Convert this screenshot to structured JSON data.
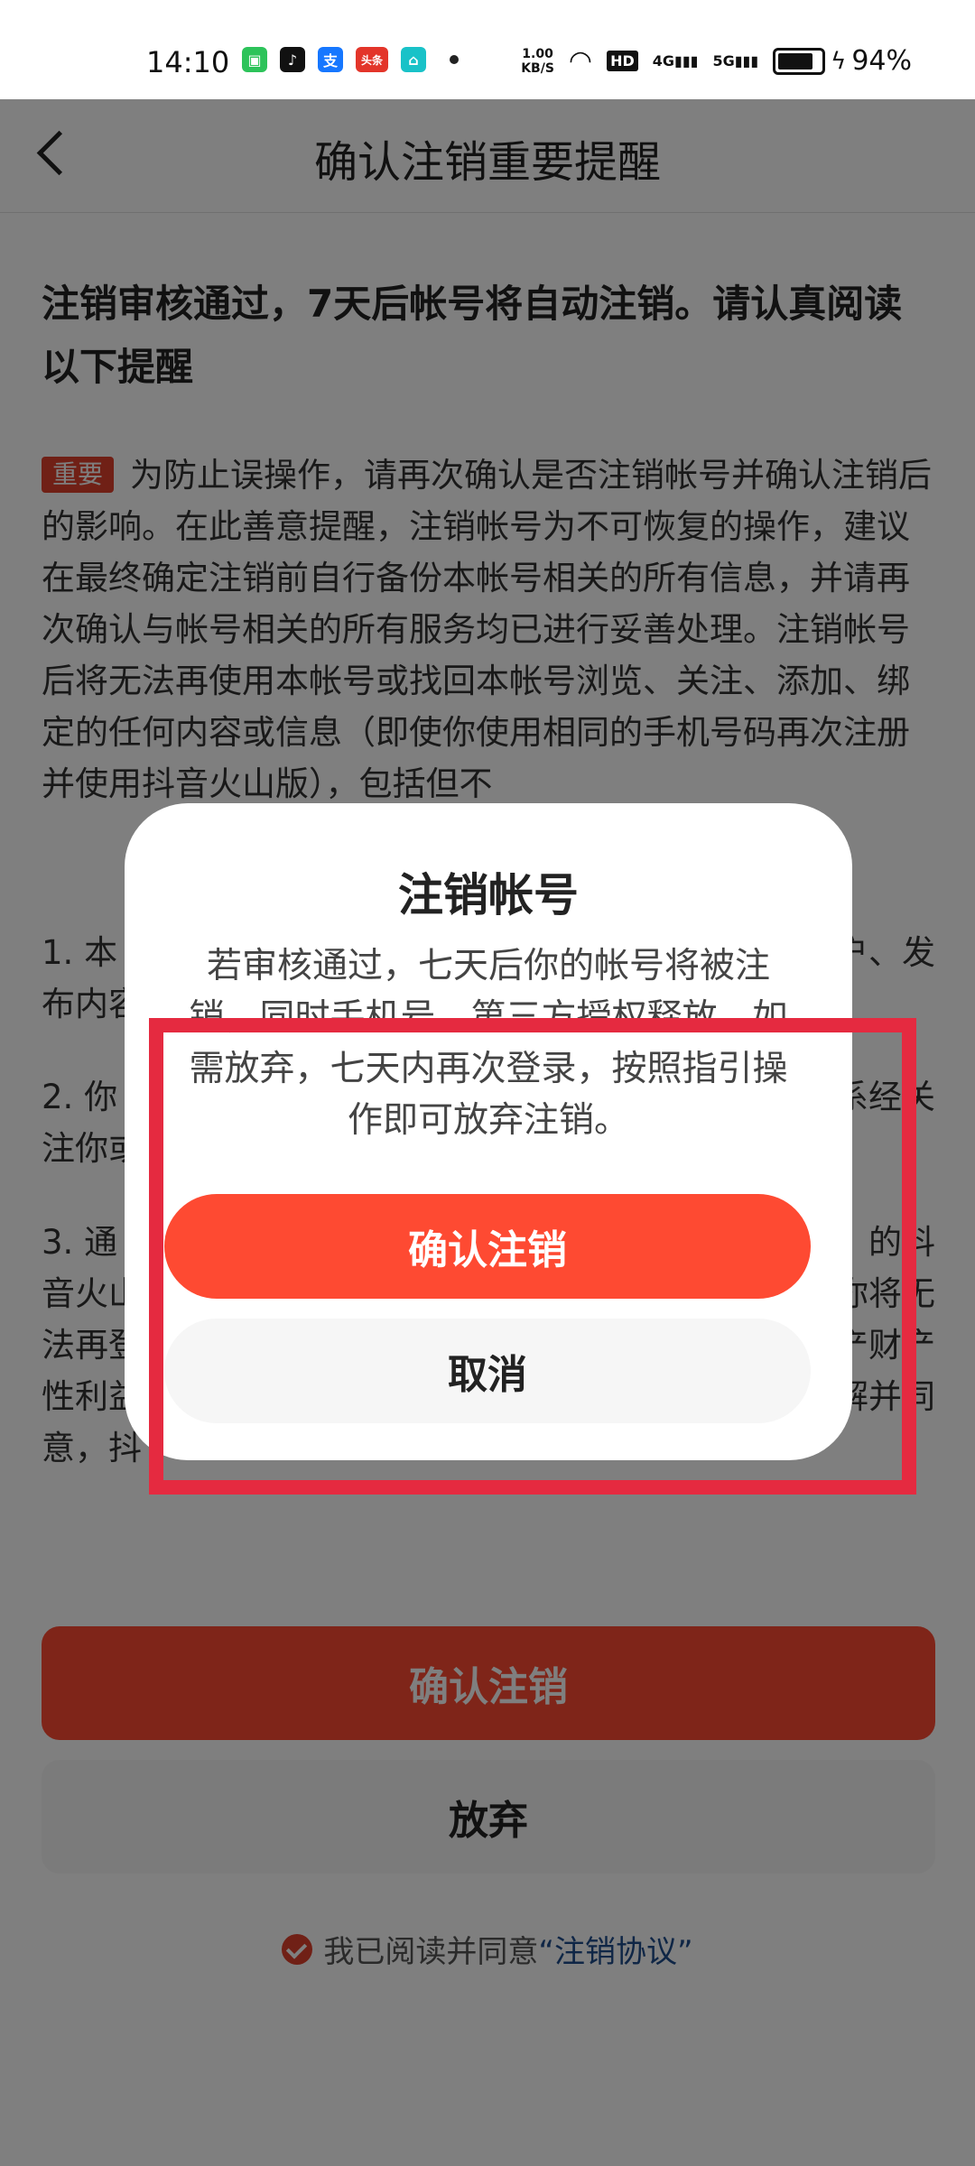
{
  "status_bar": {
    "time": "14:10",
    "net_speed_value": "1.00",
    "net_speed_unit": "KB/S",
    "hd": "HD",
    "signal1": "4G",
    "signal2": "5G",
    "battery": "94%",
    "battery_level": 0.94,
    "app_icons": [
      "wechat-icon",
      "douyin-icon",
      "alipay-icon",
      "toutiao-icon",
      "home-app-icon"
    ],
    "toutiao_text": "头条",
    "alipay_text": "支"
  },
  "nav": {
    "title": "确认注销重要提醒"
  },
  "content": {
    "headline": "注销审核通过，7天后帐号将自动注销。请认真阅读以下提醒",
    "tag": "重要",
    "paragraph": "为防止误操作，请再次确认是否注销帐号并确认注销后的影响。在此善意提醒，注销帐号为不可恢复的操作，建议在最终确定注销前自行备份本帐号相关的所有信息，并请再次确认与帐号相关的所有服务均已进行妥善处理。注销帐号后将无法再使用本帐号或找回本帐号浏览、关注、添加、绑定的任何内容或信息（即使你使用相同的手机号码再次注册并使用抖音火山版），包括但不",
    "item1": "1. 本",
    "item1_right": "户、发",
    "item1_line2": "布内容",
    "item2": "2. 你",
    "item2_right": "系经关",
    "item2_line2": "注你或",
    "item3_l1_left": "3. 通",
    "item3_l1_right": "的抖",
    "item3_l2_left": "音火山",
    "item3_l2_right": "你将无",
    "item3_l3_left": "法再登",
    "item3_l3_right": "产财产",
    "item3_l4_left": "性利益",
    "item3_l4_right": "解并同",
    "item3_l5_left": "意，抖"
  },
  "bottom": {
    "confirm": "确认注销",
    "give_up": "放弃",
    "agree_text": "我已阅读并同意",
    "agree_link": "“注销协议”"
  },
  "dialog": {
    "title": "注销帐号",
    "message": "若审核通过，七天后你的帐号将被注销，同时手机号、第三方授权释放。如需放弃，七天内再次登录，按照指引操作即可放弃注销。",
    "confirm": "确认注销",
    "cancel": "取消"
  }
}
